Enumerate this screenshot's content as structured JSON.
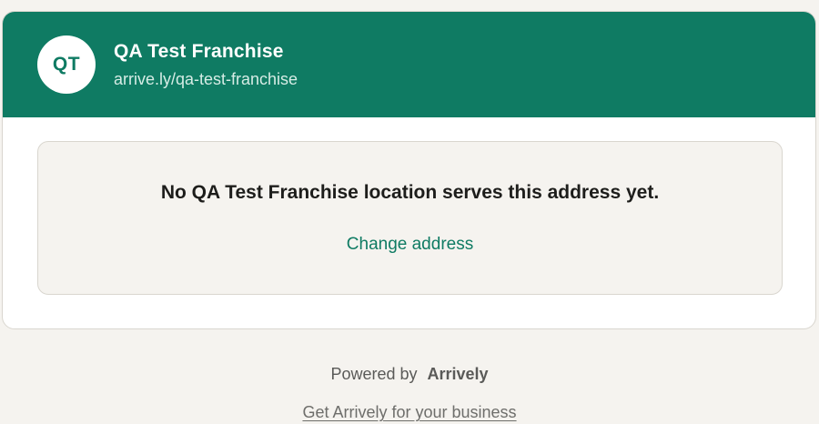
{
  "header": {
    "avatar_initials": "QT",
    "business_name": "QA Test Franchise",
    "business_url": "arrive.ly/qa-test-franchise"
  },
  "notice": {
    "message": "No QA Test Franchise location serves this address yet.",
    "change_address_label": "Change address"
  },
  "footer": {
    "powered_by_label": "Powered by",
    "powered_by_brand": "Arrively",
    "cta_link": "Get Arrively for your business"
  },
  "colors": {
    "brand_green": "#0f7b63",
    "page_background": "#f5f3ef",
    "card_background": "#ffffff"
  }
}
